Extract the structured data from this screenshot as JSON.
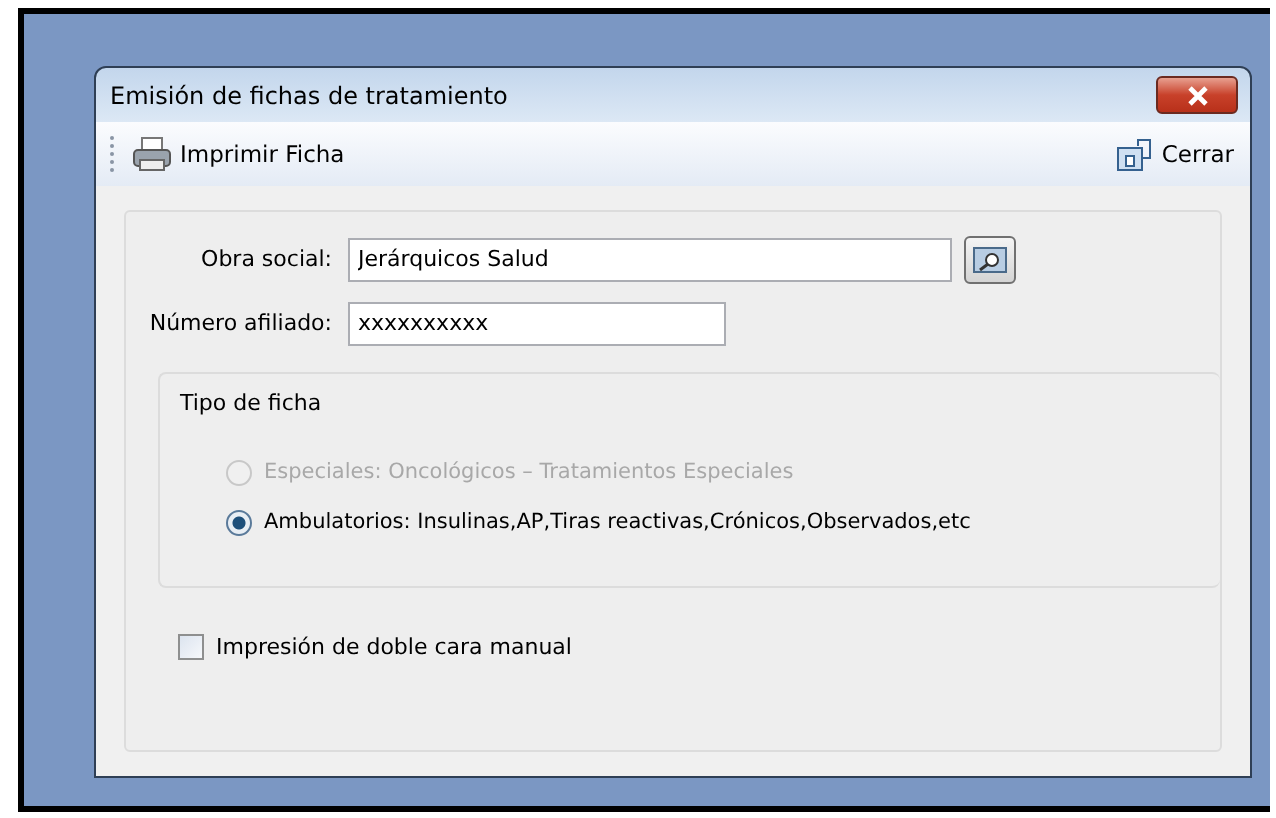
{
  "window": {
    "title": "Emisión de fichas de tratamiento"
  },
  "toolbar": {
    "print": "Imprimir Ficha",
    "close": "Cerrar"
  },
  "fields": [
    {
      "label": "Obra social:",
      "value": "Jerárquicos Salud",
      "lookup": true
    },
    {
      "label": "Número afiliado:",
      "value": "xxxxxxxxxx",
      "lookup": false
    }
  ],
  "tipo_de_ficha": {
    "title": "Tipo de ficha",
    "options": [
      {
        "label": "Especiales: Oncológicos – Tratamientos Especiales",
        "selected": false,
        "disabled": true
      },
      {
        "label": "Ambulatorios: Insulinas,AP,Tiras reactivas,Crónicos,Observados,etc",
        "selected": true,
        "disabled": false
      }
    ]
  },
  "duplex": {
    "label": "Impresión de doble cara manual",
    "checked": false
  }
}
